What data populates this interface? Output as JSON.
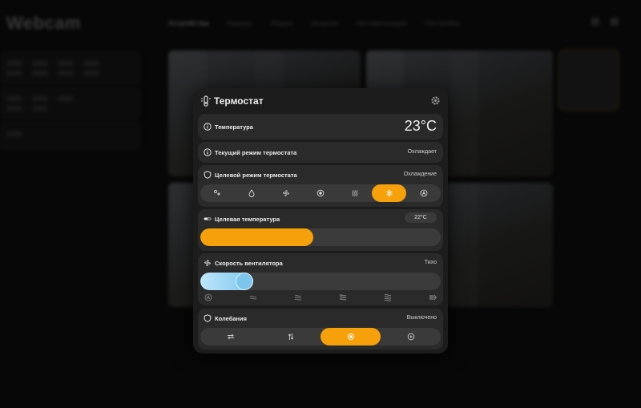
{
  "app": {
    "title": "Webcam",
    "nav": [
      "Устройства",
      "Камеры",
      "Медиа",
      "Энергия",
      "Автоматизация",
      "Настройки"
    ]
  },
  "colors": {
    "accent": "#f6a10c",
    "fan_start": "#bfe6fb",
    "fan_end": "#7cc6ee",
    "card": "#2a2a2a",
    "dialog": "#1c1c1c"
  },
  "dialog": {
    "title": "Термостат",
    "icon": "thermostat-icon",
    "settings_icon": "gear-icon",
    "temperature": {
      "label": "Температура",
      "value": "23°C",
      "icon": "info-icon"
    },
    "current_mode": {
      "label": "Текущий режим термостата",
      "value": "Охлаждает",
      "icon": "info-icon"
    },
    "target_mode": {
      "label": "Целевой режим термостата",
      "value": "Охлаждение",
      "icon": "shield-icon",
      "options": [
        "heat-cool",
        "dry",
        "fan",
        "off",
        "heat",
        "cool",
        "auto"
      ],
      "selected": "cool"
    },
    "target_temperature": {
      "label": "Целевая температура",
      "value": "22°C",
      "icon": "thermometer-icon",
      "level": 0.47
    },
    "fan_speed": {
      "label": "Скорость вентилятора",
      "value": "Тихо",
      "icon": "fan-icon",
      "level": 0.22,
      "ticks": [
        "auto",
        "low",
        "medium-low",
        "medium",
        "high",
        "turbo"
      ]
    },
    "swing": {
      "label": "Колебания",
      "value": "Выключено",
      "icon": "shield-icon",
      "options": [
        "horizontal",
        "vertical",
        "off",
        "both"
      ],
      "selected": "off"
    }
  }
}
